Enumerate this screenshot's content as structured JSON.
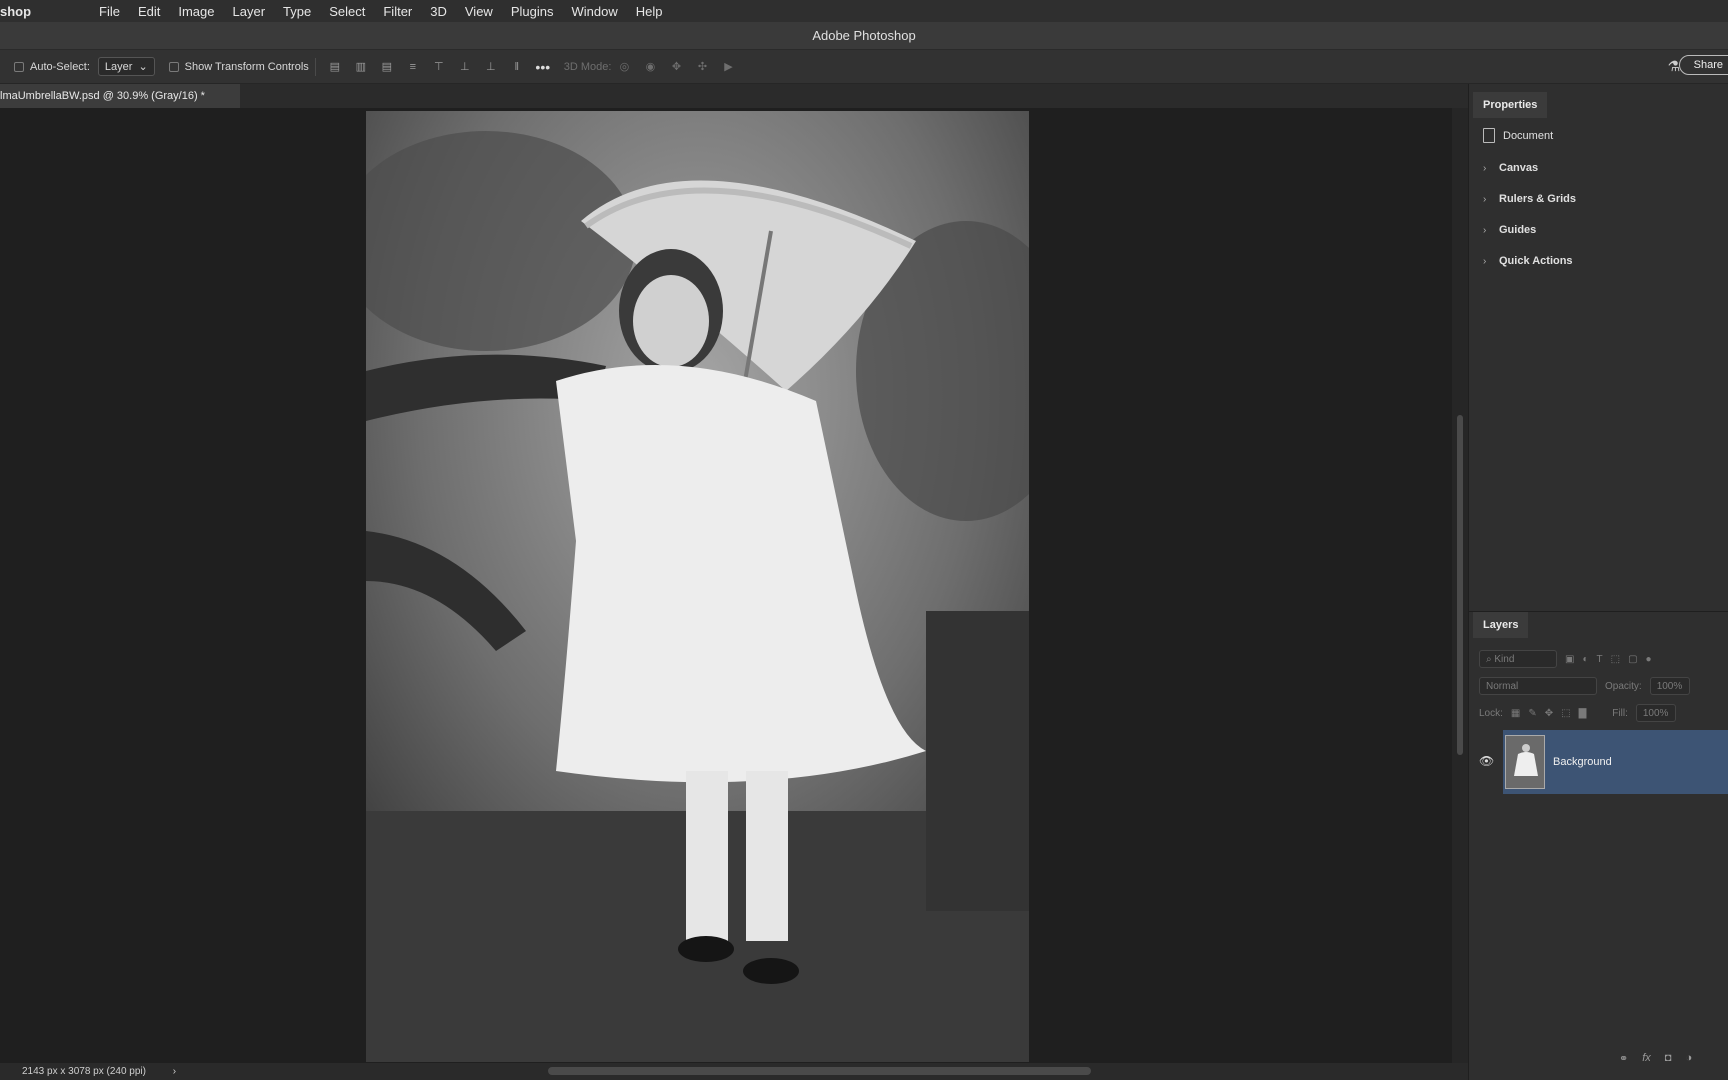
{
  "menubar": {
    "app": "shop",
    "items": [
      "File",
      "Edit",
      "Image",
      "Layer",
      "Type",
      "Select",
      "Filter",
      "3D",
      "View",
      "Plugins",
      "Window",
      "Help"
    ]
  },
  "window": {
    "title": "Adobe Photoshop"
  },
  "options": {
    "auto_select_label": "Auto-Select:",
    "auto_select_value": "Layer",
    "transform_label": "Show Transform Controls",
    "mode_3d_label": "3D Mode:",
    "share_label": "Share"
  },
  "document": {
    "tab_title": "lmaUmbrellaBW.psd @ 30.9% (Gray/16) *",
    "status": "2143 px x 3078 px (240 ppi)"
  },
  "properties": {
    "tab_label": "Properties",
    "doc_label": "Document",
    "sections": [
      "Canvas",
      "Rulers & Grids",
      "Guides",
      "Quick Actions"
    ]
  },
  "layers": {
    "tab_label": "Layers",
    "filter_placeholder": "Kind",
    "blend_mode": "Normal",
    "opacity_label": "Opacity:",
    "opacity_value": "100%",
    "lock_label": "Lock:",
    "fill_label": "Fill:",
    "fill_value": "100%",
    "items": [
      {
        "name": "Background",
        "visible": true,
        "selected": true
      }
    ]
  }
}
